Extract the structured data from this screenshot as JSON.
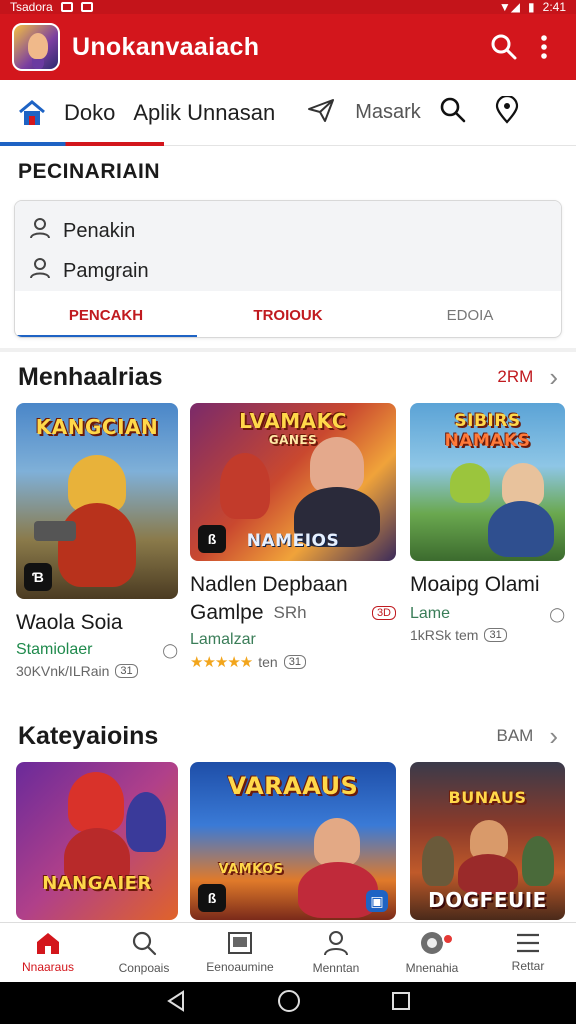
{
  "status_bar": {
    "left_text": "Tsadora",
    "time": "2:41"
  },
  "app_bar": {
    "title": "Unokanvaaiach",
    "search_icon": "search-icon",
    "menu_icon": "more-vert-icon"
  },
  "top_nav": {
    "items": [
      "Doko",
      "Aplik Unnasan",
      "Masark"
    ],
    "icons": [
      "home-icon",
      "send-icon",
      "search-icon",
      "location-icon"
    ]
  },
  "filter": {
    "heading": "PECINARIAIN",
    "rows": [
      "Penakin",
      "Pamgrain"
    ],
    "tabs": [
      "PENCAKH",
      "TROIOUK",
      "EDOIA"
    ]
  },
  "section1": {
    "title": "Menhaalrias",
    "more": "2RM",
    "cards": [
      {
        "thumb_title": "KANGCIAN",
        "badge": "Ɓ",
        "name": "Waola Soia",
        "sub": "Stamiolaer",
        "meta": "30KVnk/ILRain",
        "chip": "31"
      },
      {
        "thumb_title": "LVAMAKC",
        "thumb_subtitle": "GANES",
        "thumb_bottom": "NAMEIOS",
        "badge": "ß",
        "name": "Nadlen Depbaan",
        "name2": "Gamlpe",
        "name2_extra": "SRh",
        "chip_red": "3D",
        "sub": "Lamalzar",
        "rating": "★★★★★",
        "meta": "ten",
        "chip": "31"
      },
      {
        "thumb_title": "SIBIRS",
        "thumb_subtitle": "NAMAKS",
        "name": "Moaipg Olami",
        "sub": "Lame",
        "meta": "1kRSk tem",
        "chip": "31"
      }
    ]
  },
  "section2": {
    "title": "Kateyaioins",
    "more": "BAM",
    "cards": [
      {
        "thumb_title": "NANGAIER",
        "badge": ""
      },
      {
        "thumb_title": "VARAAUS",
        "thumb_bottom": "VAMKOS",
        "badge": "ß"
      },
      {
        "thumb_title": "BUNAUS",
        "thumb_bottom": "DOGFEUIE"
      }
    ]
  },
  "bottom_nav": {
    "items": [
      {
        "label": "Nnaaraus",
        "icon": "home-icon"
      },
      {
        "label": "Conpoais",
        "icon": "search-icon"
      },
      {
        "label": "Eenoaumine",
        "icon": "image-icon"
      },
      {
        "label": "Menntan",
        "icon": "person-icon"
      },
      {
        "label": "Mnenahia",
        "icon": "camera-icon"
      },
      {
        "label": "Rettar",
        "icon": "menu-icon"
      }
    ]
  },
  "colors": {
    "brand_red": "#d3161c",
    "accent_blue": "#1e63c4",
    "rating_orange": "#f2a51c",
    "sub_green": "#1f8a4c"
  }
}
